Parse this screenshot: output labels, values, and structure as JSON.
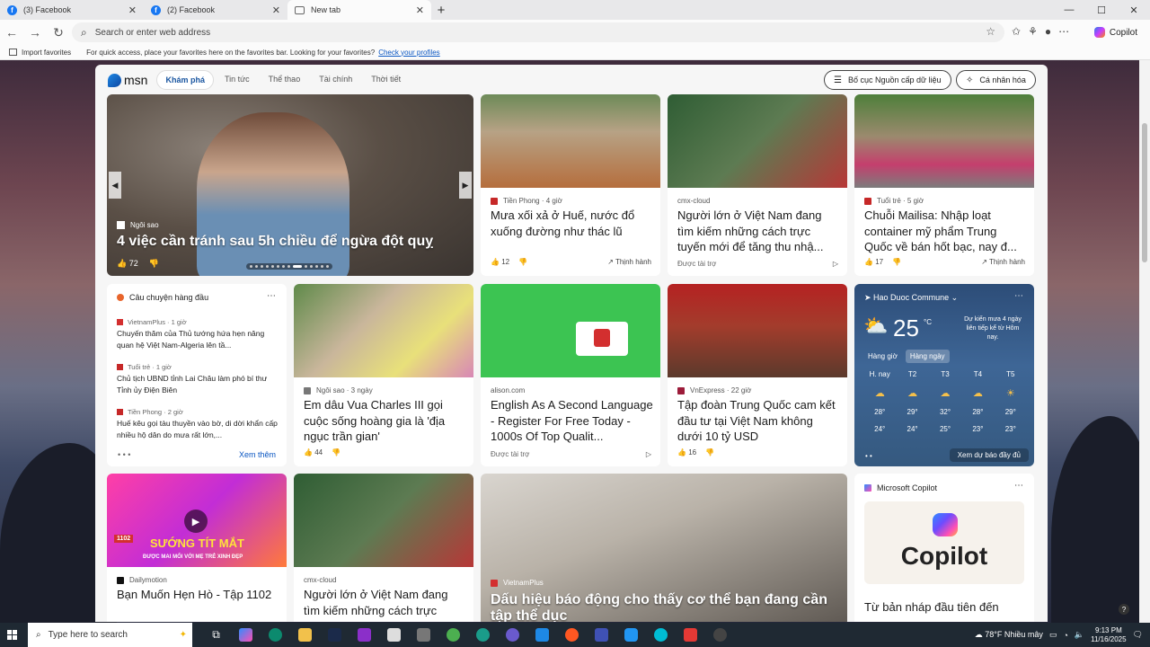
{
  "tabs": [
    {
      "label": "(3) Facebook"
    },
    {
      "label": "(2) Facebook"
    },
    {
      "label": "New tab"
    }
  ],
  "address": {
    "placeholder": "Search or enter web address"
  },
  "copilot_label": "Copilot",
  "favbar": {
    "import": "Import favorites",
    "message": "For quick access, place your favorites here on the favorites bar. Looking for your favorites?",
    "link": "Check your profiles"
  },
  "msn": {
    "logo": "msn",
    "nav": [
      "Khám phá",
      "Tin tức",
      "Thể thao",
      "Tài chính",
      "Thời tiết"
    ],
    "btn_layout": "Bố cục Nguồn cấp dữ liệu",
    "btn_personal": "Cá nhân hóa"
  },
  "hero": {
    "source": "Ngôi sao",
    "title": "4 việc cần tránh sau 5h chiều để ngừa đột quỵ",
    "likes": "72"
  },
  "cards": {
    "c1": {
      "source": "Tiền Phong · 4 giờ",
      "title": "Mưa xối xả ở Huế, nước đổ xuống đường như thác lũ",
      "likes": "12",
      "trend": "Thịnh hành"
    },
    "c2": {
      "source": "cmx-cloud",
      "title": "Người lớn ở Việt Nam đang tìm kiếm những cách trực tuyến mới để tăng thu nhậ...",
      "ad": "Được tài trợ"
    },
    "c3": {
      "source": "Tuổi trẻ · 5 giờ",
      "title": "Chuỗi Mailisa: Nhập loạt container mỹ phẩm Trung Quốc về bán hốt bạc, nay đ...",
      "likes": "17",
      "trend": "Thịnh hành"
    },
    "c4": {
      "source": "Ngôi sao · 3 ngày",
      "title": "Em dâu Vua Charles III gọi cuộc sống hoàng gia là 'địa ngục trần gian'",
      "likes": "44"
    },
    "c5": {
      "source": "alison.com",
      "title": "English As A Second Language - Register For Free Today - 1000s Of Top Qualit...",
      "ad": "Được tài trợ"
    },
    "c6": {
      "source": "VnExpress · 22 giờ",
      "title": "Tập đoàn Trung Quốc cam kết đầu tư tại Việt Nam không dưới 10 tỷ USD",
      "likes": "16"
    },
    "c7": {
      "source": "Dailymotion",
      "title": "Bạn Muốn Hẹn Hò - Tập 1102",
      "thumb_text": "SƯỚNG TÍT MẮT",
      "thumb_sub": "ĐƯỢC MAI MỐI VỚI MẸ TRẺ XINH ĐẸP",
      "ep": "1102"
    },
    "c8": {
      "source": "cmx-cloud",
      "title": "Người lớn ở Việt Nam đang tìm kiếm những cách trực"
    },
    "c9": {
      "source": "VietnamPlus",
      "title": "Dấu hiệu báo động cho thấy cơ thể bạn đang cần tập thể dục"
    }
  },
  "topstories": {
    "header": "Câu chuyện hàng đầu",
    "items": [
      {
        "source": "VietnamPlus · 1 giờ",
        "text": "Chuyến thăm của Thủ tướng hứa hẹn nâng quan hệ Việt Nam-Algeria lên tầ..."
      },
      {
        "source": "Tuổi trẻ · 1 giờ",
        "text": "Chủ tịch UBND tỉnh Lai Châu làm phó bí thư Tỉnh ủy Điện Biên"
      },
      {
        "source": "Tiền Phong · 2 giờ",
        "text": "Huế kêu gọi tàu thuyền vào bờ, di dời khẩn cấp nhiều hộ dân do mưa rất lớn,..."
      }
    ],
    "more": "Xem thêm"
  },
  "weather": {
    "location": "Hao Duoc Commune",
    "temp": "25",
    "unit": "°C",
    "note": "Dự kiến mưa 4 ngày liên tiếp kể từ Hôm nay.",
    "tabs": [
      "Hàng giờ",
      "Hàng ngày"
    ],
    "days": [
      "H. nay",
      "T2",
      "T3",
      "T4",
      "T5"
    ],
    "highs": [
      "28°",
      "29°",
      "32°",
      "28°",
      "29°"
    ],
    "lows": [
      "24°",
      "24°",
      "25°",
      "23°",
      "23°"
    ],
    "more": "Xem dự báo đầy đủ"
  },
  "copilot_card": {
    "source": "Microsoft Copilot",
    "word": "Copilot",
    "title": "Từ bản nháp đầu tiên đến"
  },
  "taskbar": {
    "search": "Type here to search",
    "weather": "78°F  Nhiều mây",
    "time": "9:13 PM",
    "date": "11/16/2025"
  }
}
